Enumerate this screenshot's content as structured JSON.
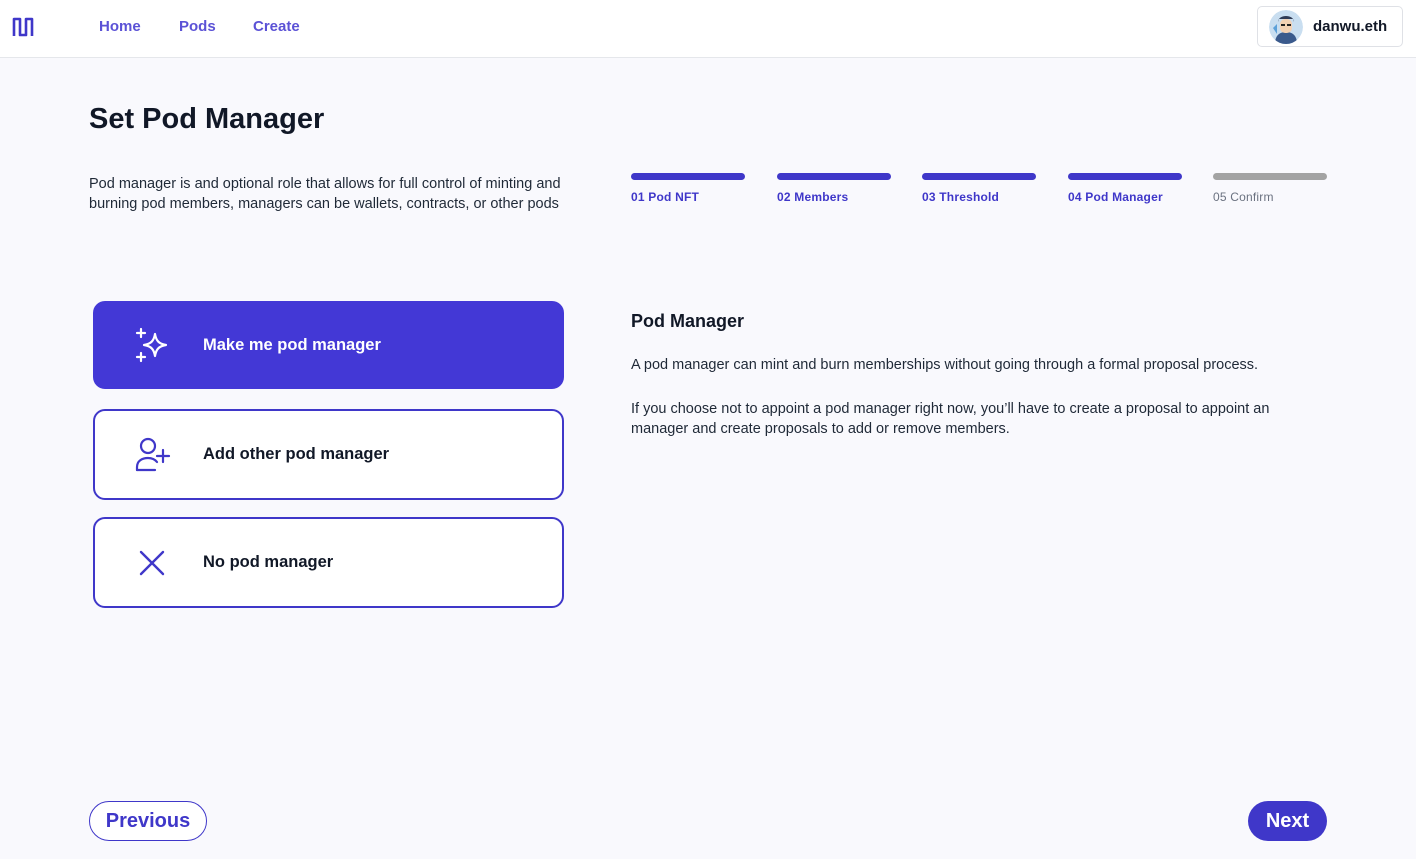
{
  "nav": {
    "items": [
      {
        "label": "Home"
      },
      {
        "label": "Pods"
      },
      {
        "label": "Create"
      }
    ]
  },
  "profile": {
    "name": "danwu.eth"
  },
  "page": {
    "title": "Set Pod Manager",
    "intro": "Pod manager is and optional role that allows for full control of minting and burning pod members, managers can be wallets, contracts, or other pods"
  },
  "steps": [
    {
      "label": "01 Pod NFT",
      "status": "complete"
    },
    {
      "label": "02 Members",
      "status": "complete"
    },
    {
      "label": "03 Threshold",
      "status": "complete"
    },
    {
      "label": "04 Pod Manager",
      "status": "current"
    },
    {
      "label": "05 Confirm",
      "status": "pending"
    }
  ],
  "options": [
    {
      "label": "Make me pod manager",
      "icon": "sparkles-icon",
      "selected": true
    },
    {
      "label": "Add other pod manager",
      "icon": "user-plus-icon",
      "selected": false
    },
    {
      "label": "No pod manager",
      "icon": "x-icon",
      "selected": false
    }
  ],
  "info": {
    "title": "Pod Manager",
    "paragraph1": "A pod manager can mint and burn memberships without going through a formal proposal process.",
    "paragraph2": "If you choose not to appoint a pod manager right now, you’ll have to create a proposal to appoint an manager and create proposals to add or remove members."
  },
  "footer": {
    "previous_label": "Previous",
    "next_label": "Next"
  },
  "colors": {
    "accent": "#3f37c9",
    "accent_selected": "#4338d6",
    "pending": "#a3a3a3",
    "background": "#f9f9fd"
  }
}
